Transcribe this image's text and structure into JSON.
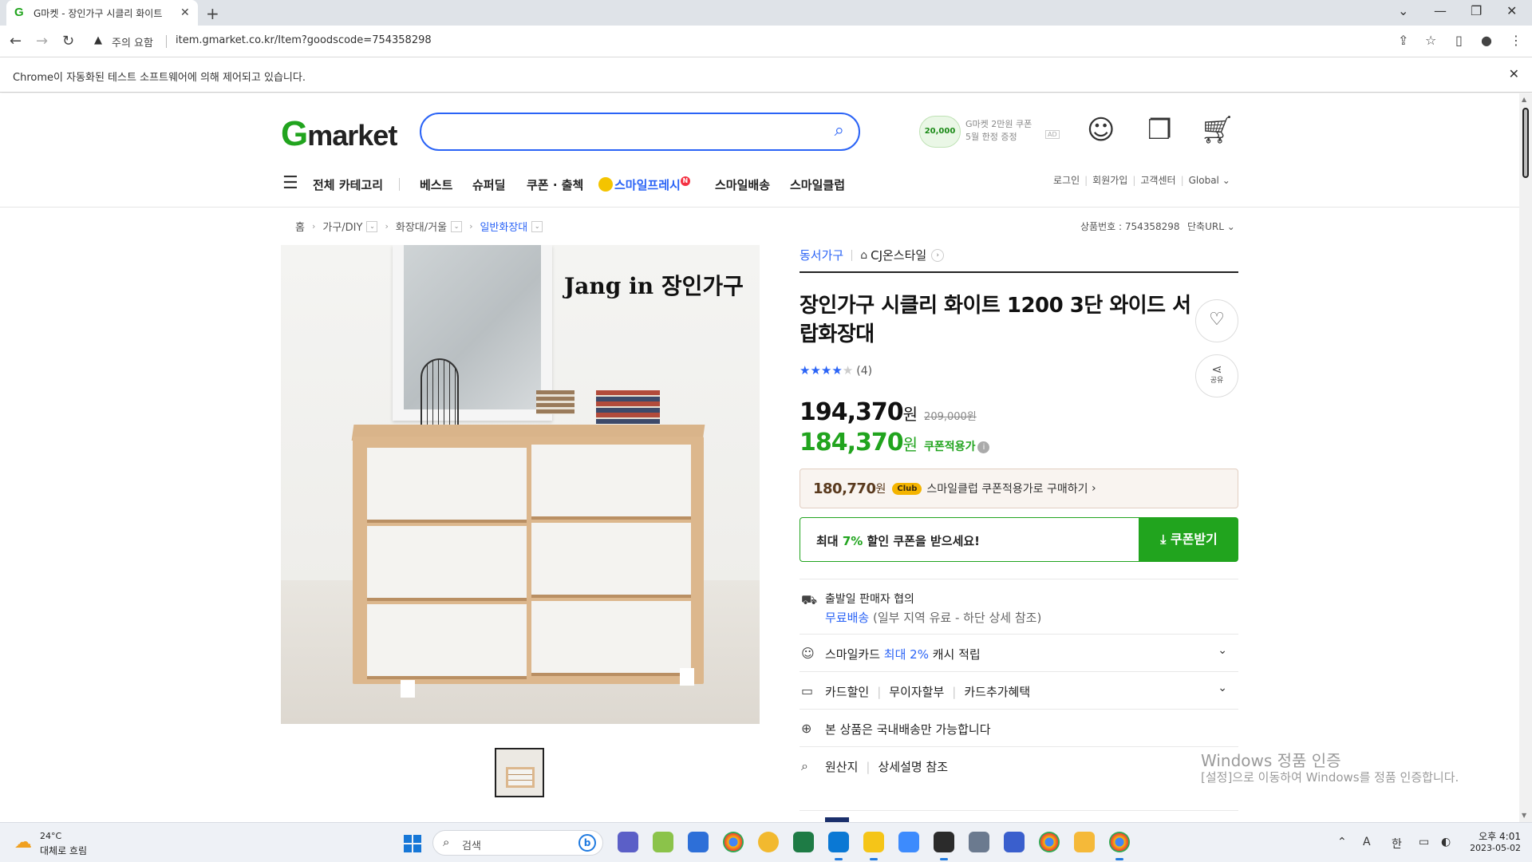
{
  "browser": {
    "tab_title": "G마켓 - 장인가구 시클리 화이트",
    "url_warning": "주의 요함",
    "url": "item.gmarket.co.kr/Item?goodscode=754358298",
    "automation_notice": "Chrome이 자동화된 테스트 소프트웨어에 의해 제어되고 있습니다."
  },
  "header": {
    "logo_g": "G",
    "logo_rest": "market",
    "search_placeholder": "",
    "promo_coin": "20,000",
    "promo_line1": "G마켓 2만원 쿠폰",
    "promo_line2": "5월 한정 증정",
    "promo_ad": "AD"
  },
  "gnb": {
    "category": "전체 카테고리",
    "items": [
      "베스트",
      "슈퍼딜",
      "쿠폰 · 출첵",
      "스마일프레시",
      "스마일배송",
      "스마일클럽"
    ],
    "new_badge": "N",
    "util": [
      "로그인",
      "회원가입",
      "고객센터",
      "Global"
    ]
  },
  "breadcrumb": [
    "홈",
    "가구/DIY",
    "화장대/거울",
    "일반화장대"
  ],
  "product": {
    "goods_no": "상품번호 : 754358298",
    "short_url": "단축URL",
    "image_brand_text": "Jang in 장인가구",
    "seller_category": "동서가구",
    "store": "CJ온스타일",
    "title": "장인가구 시클리 화이트 1200 3단 와이드 서랍화장대",
    "rating": 4,
    "review_count": "(4)",
    "share_label": "공유",
    "price": "194,370",
    "won": "원",
    "original_price": "209,000원",
    "coupon_price": "184,370",
    "coupon_label": "쿠폰적용가",
    "club_price": "180,770",
    "club_won": "원",
    "club_badge": "Club",
    "club_text": "스마일클럽 쿠폰적용가로 구매하기",
    "coupon_msg_prefix": "최대 ",
    "coupon_msg_pct": "7%",
    "coupon_msg_suffix": " 할인 쿠폰을 받으세요!",
    "coupon_button": "쿠폰받기"
  },
  "info_rows": {
    "ship_line1": "출발일 판매자 협의",
    "ship_free": "무료배송",
    "ship_note": "(일부 지역 유료 - 하단 상세 참조)",
    "card_prefix": "스마일카드 ",
    "card_blue": "최대 2%",
    "card_suffix": " 캐시 적립",
    "card_discount": "카드할인",
    "installment": "무이자할부",
    "card_extra": "카드추가혜택",
    "domestic": "본 상품은 국내배송만 가능합니다",
    "origin": "원산지",
    "origin_value": "상세설명 참조"
  },
  "watermark": {
    "line1": "Windows 정품 인증",
    "line2": "[설정]으로 이동하여 Windows를 정품 인증합니다."
  },
  "taskbar": {
    "temp": "24°C",
    "weather": "대체로 흐림",
    "search": "검색",
    "ime1": "A",
    "ime2": "한",
    "time": "오후 4:01",
    "date": "2023-05-02"
  }
}
